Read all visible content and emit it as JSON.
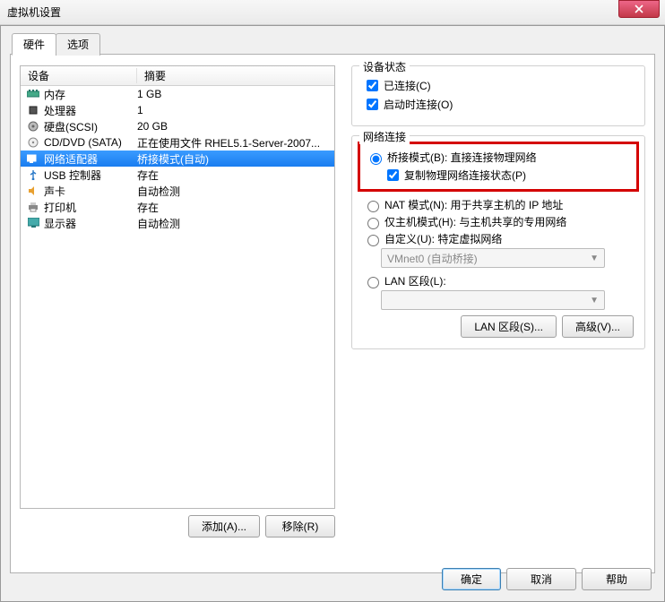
{
  "window": {
    "title": "虚拟机设置"
  },
  "tabs": {
    "hardware": "硬件",
    "options": "选项"
  },
  "list": {
    "head_device": "设备",
    "head_summary": "摘要",
    "rows": [
      {
        "name": "内存",
        "value": "1 GB"
      },
      {
        "name": "处理器",
        "value": "1"
      },
      {
        "name": "硬盘(SCSI)",
        "value": "20 GB"
      },
      {
        "name": "CD/DVD (SATA)",
        "value": "正在使用文件 RHEL5.1-Server-2007..."
      },
      {
        "name": "网络适配器",
        "value": "桥接模式(自动)"
      },
      {
        "name": "USB 控制器",
        "value": "存在"
      },
      {
        "name": "声卡",
        "value": "自动检测"
      },
      {
        "name": "打印机",
        "value": "存在"
      },
      {
        "name": "显示器",
        "value": "自动检测"
      }
    ],
    "add_btn": "添加(A)...",
    "remove_btn": "移除(R)"
  },
  "status": {
    "title": "设备状态",
    "connected": "已连接(C)",
    "connect_at_power": "启动时连接(O)"
  },
  "net": {
    "title": "网络连接",
    "bridge": "桥接模式(B): 直接连接物理网络",
    "replicate": "复制物理网络连接状态(P)",
    "nat": "NAT 模式(N): 用于共享主机的 IP 地址",
    "hostonly": "仅主机模式(H): 与主机共享的专用网络",
    "custom": "自定义(U): 特定虚拟网络",
    "vmnet_sel": "VMnet0 (自动桥接)",
    "lan": "LAN 区段(L):",
    "lan_btn": "LAN 区段(S)...",
    "adv_btn": "高级(V)..."
  },
  "buttons": {
    "ok": "确定",
    "cancel": "取消",
    "help": "帮助"
  }
}
